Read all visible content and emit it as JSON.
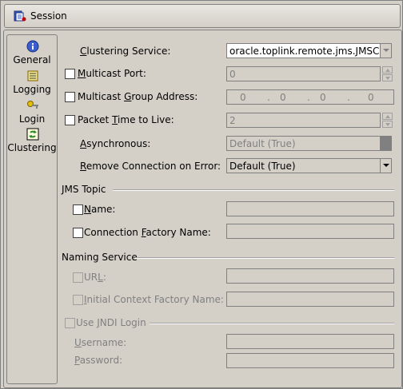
{
  "window": {
    "title": "Session"
  },
  "nav": {
    "items": [
      {
        "label": "General",
        "icon": "info-icon"
      },
      {
        "label": "Logging",
        "icon": "logging-icon"
      },
      {
        "label": "Login",
        "icon": "key-icon"
      },
      {
        "label": "Clustering",
        "icon": "clustering-icon"
      }
    ]
  },
  "form": {
    "clustering_service": {
      "label": "Clustering Service:",
      "value": "oracle.toplink.remote.jms.JMSClust"
    },
    "multicast_port": {
      "label": "Multicast Port:",
      "value": "0"
    },
    "multicast_group_address": {
      "label": "Multicast Group Address:",
      "octets": [
        "0",
        "0",
        "0",
        "0"
      ]
    },
    "packet_ttl": {
      "label": "Packet Time to Live:",
      "value": "2"
    },
    "asynchronous": {
      "label": "Asynchronous:",
      "value": "Default (True)"
    },
    "remove_connection": {
      "label": "Remove Connection on Error:",
      "value": "Default (True)"
    }
  },
  "jms_topic": {
    "header": "JMS Topic",
    "name_label": "Name:",
    "name_value": "",
    "factory_label": "Connection Factory Name:",
    "factory_value": ""
  },
  "naming_service": {
    "header": "Naming Service",
    "url_label": "URL:",
    "url_value": "",
    "context_label": "Initial Context Factory Name:",
    "context_value": ""
  },
  "jndi": {
    "label": "Use JNDI Login",
    "username_label": "Username:",
    "username_value": "",
    "password_label": "Password:",
    "password_value": ""
  }
}
